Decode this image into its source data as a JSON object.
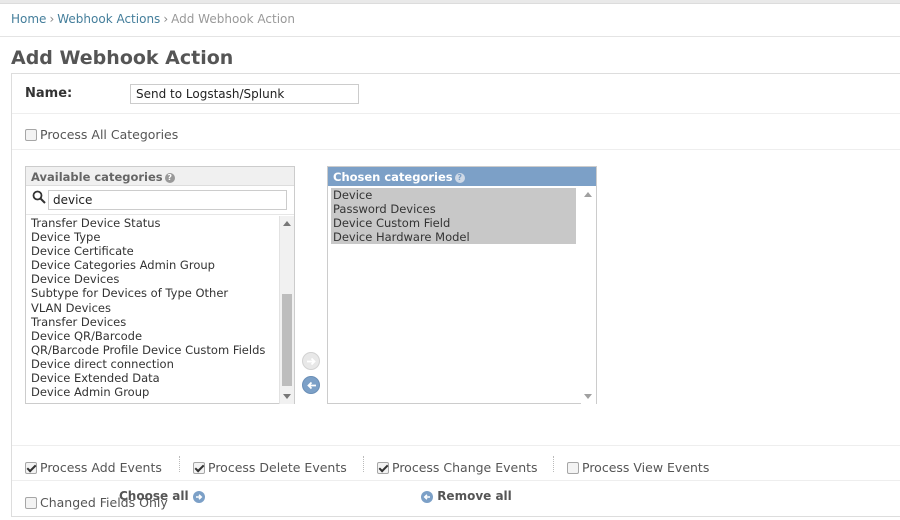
{
  "breadcrumbs": {
    "home": "Home",
    "section": "Webhook Actions",
    "current": "Add Webhook Action",
    "separator": "›"
  },
  "page_title": "Add Webhook Action",
  "form": {
    "name_label": "Name:",
    "name_value": "Send to Logstash/Splunk",
    "process_all_categories": {
      "label": "Process All Categories",
      "checked": false
    }
  },
  "available": {
    "title": "Available categories",
    "filter_value": "device",
    "items": [
      "Transfer Device Status",
      "Device Type",
      "Device Certificate",
      "Device Categories Admin Group",
      "Device Devices",
      "Subtype for Devices of Type Other",
      "VLAN Devices",
      "Transfer Devices",
      "Device QR/Barcode",
      "QR/Barcode Profile Device Custom Fields",
      "Device direct connection",
      "Device Extended Data",
      "Device Admin Group"
    ],
    "choose_all_label": "Choose all"
  },
  "chosen": {
    "title": "Chosen categories",
    "items": [
      "Device",
      "Password Devices",
      "Device Custom Field",
      "Device Hardware Model"
    ],
    "remove_all_label": "Remove all"
  },
  "events": [
    {
      "label": "Process Add Events",
      "checked": true
    },
    {
      "label": "Process Delete Events",
      "checked": true
    },
    {
      "label": "Process Change Events",
      "checked": true
    },
    {
      "label": "Process View Events",
      "checked": false
    }
  ],
  "changed_fields_only": {
    "label": "Changed Fields Only",
    "checked": false
  },
  "colors": {
    "link": "#447e9b",
    "chosen_header": "#7ca0c7",
    "selected_bg": "#c8c8c8"
  }
}
